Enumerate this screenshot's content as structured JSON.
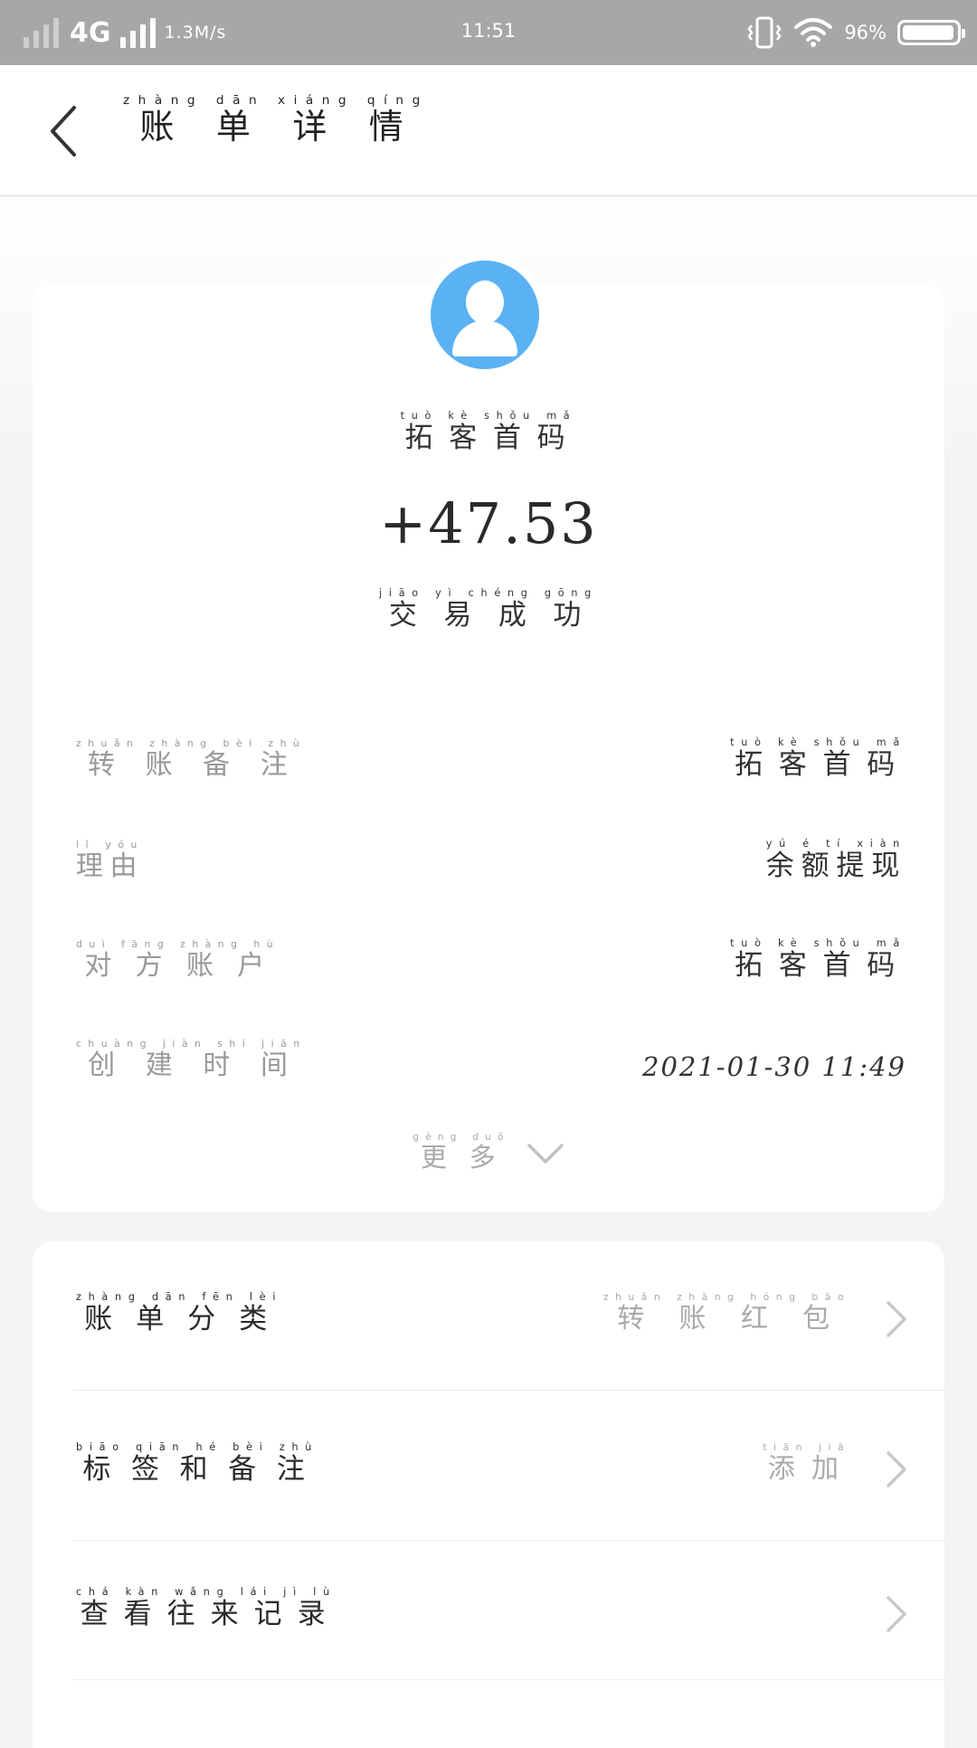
{
  "status_bar": {
    "network": "4G",
    "speed": "1.3M/s",
    "time": "11:51",
    "battery": "96%",
    "battery_level": 0.96
  },
  "nav": {
    "title": "账单详情",
    "title_pinyin": "zhàng dān xiáng qíng"
  },
  "transaction": {
    "merchant": "拓客首码",
    "merchant_pinyin": "tuò kè shǒu mǎ",
    "amount": "+47.53",
    "status": "交易成功",
    "status_pinyin": "jiāo yì chéng gōng",
    "avatar_icon": "user-avatar-icon",
    "avatar_color": "#5ab2f4"
  },
  "details": [
    {
      "label": "转账备注",
      "label_pinyin": "zhuǎn zhàng bèi zhù",
      "value": "拓客首码",
      "value_pinyin": "tuò kè shǒu mǎ"
    },
    {
      "label": "理由",
      "label_pinyin": "lǐ yóu",
      "value": "余额提现",
      "value_pinyin": "yú é tí xiàn"
    },
    {
      "label": "对方账户",
      "label_pinyin": "duì fāng zhàng hù",
      "value": "拓客首码",
      "value_pinyin": "tuò kè shǒu mǎ"
    },
    {
      "label": "创建时间",
      "label_pinyin": "chuàng jiàn shí jiān",
      "value": "2021-01-30 11:49",
      "value_pinyin": ""
    }
  ],
  "more": {
    "label": "更多",
    "label_pinyin": "gèng duō"
  },
  "actions": [
    {
      "label": "账单分类",
      "label_pinyin": "zhàng dān fēn lèi",
      "value": "转账红包",
      "value_pinyin": "zhuǎn zhàng hóng bāo"
    },
    {
      "label": "标签和备注",
      "label_pinyin": "biāo qiān hé bèi zhù",
      "value": "添加",
      "value_pinyin": "tiān jiā"
    },
    {
      "label": "查看往来记录",
      "label_pinyin": "chá kàn wǎng lái jì lù",
      "value": "",
      "value_pinyin": ""
    }
  ]
}
